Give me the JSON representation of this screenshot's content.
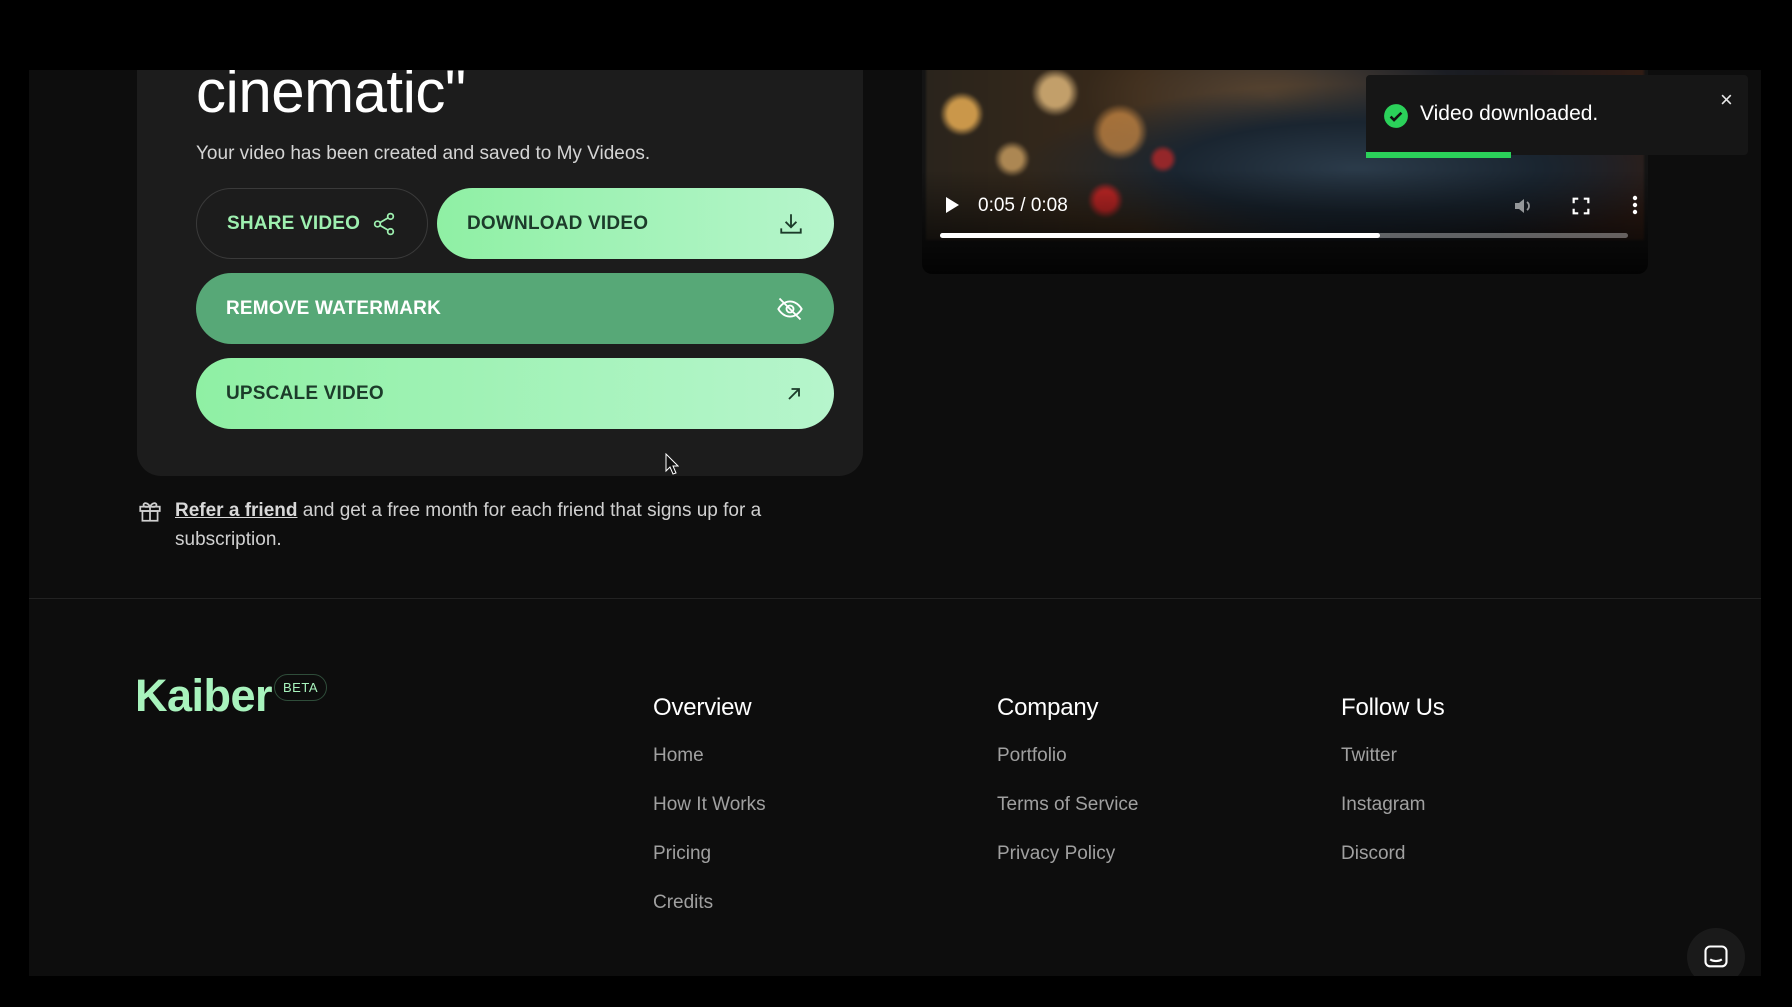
{
  "result": {
    "title_fragment": "cinematic\"",
    "subtitle": "Your video has been created and saved to My Videos.",
    "share_label": "SHARE VIDEO",
    "download_label": "DOWNLOAD VIDEO",
    "watermark_label": "REMOVE WATERMARK",
    "upscale_label": "UPSCALE VIDEO"
  },
  "refer": {
    "link": "Refer a friend",
    "text": " and get a free month for each friend that signs up for a subscription."
  },
  "player": {
    "time": "0:05 / 0:08",
    "progress_fraction": 0.64
  },
  "toast": {
    "message": "Video downloaded.",
    "close": "×",
    "progress_fraction": 0.38,
    "color": "#2bd15a"
  },
  "footer": {
    "logo": "Kaiber",
    "badge": "BETA",
    "columns": [
      {
        "heading": "Overview",
        "links": [
          "Home",
          "How It Works",
          "Pricing",
          "Credits"
        ]
      },
      {
        "heading": "Company",
        "links": [
          "Portfolio",
          "Terms of Service",
          "Privacy Policy"
        ]
      },
      {
        "heading": "Follow Us",
        "links": [
          "Twitter",
          "Instagram",
          "Discord"
        ]
      }
    ]
  },
  "colors": {
    "accent": "#9ef0b0",
    "watermark_button": "#57a877",
    "background": "#0d0d0d"
  }
}
